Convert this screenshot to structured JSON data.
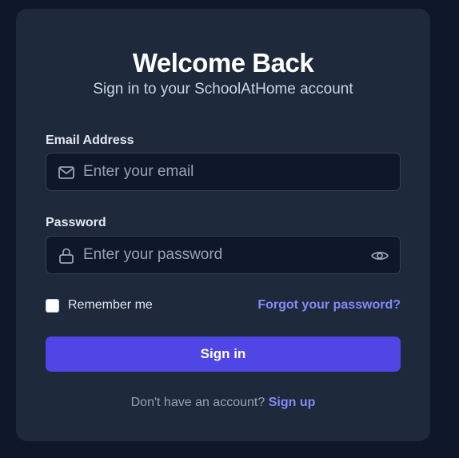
{
  "header": {
    "title": "Welcome Back",
    "subtitle": "Sign in to your SchoolAtHome account"
  },
  "form": {
    "email": {
      "label": "Email Address",
      "placeholder": "Enter your email",
      "value": "",
      "icon": "mail-icon"
    },
    "password": {
      "label": "Password",
      "placeholder": "Enter your password",
      "value": "",
      "icon": "lock-icon",
      "toggle_icon": "eye-icon"
    },
    "remember": {
      "label": "Remember me",
      "checked": false
    },
    "forgot_link": "Forgot your password?",
    "submit_label": "Sign in"
  },
  "footer": {
    "prompt": "Don't have an account?",
    "signup_link": "Sign up"
  },
  "colors": {
    "page_background": "#0f172a",
    "card_background": "#1e293b",
    "input_background": "#0f172a",
    "accent": "#4f46e5",
    "link": "#818cf8"
  }
}
